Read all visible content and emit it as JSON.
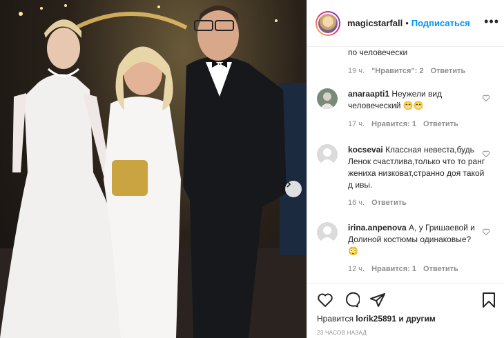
{
  "post": {
    "username": "magicstarfall",
    "separator": "•",
    "follow_label": "Подписаться",
    "more_label": "•••"
  },
  "comments": [
    {
      "text": "по человечески",
      "time": "19 ч.",
      "likes": "\"Нравится\": 2",
      "reply": "Ответить"
    },
    {
      "user": "anaraapti1",
      "text": "Неужели вид человеческий",
      "emoji": "😁😁",
      "time": "17 ч.",
      "likes": "Нравится: 1",
      "reply": "Ответить"
    },
    {
      "user": "kocsevai",
      "text": "Классная невеста,будь Ленок счастлива,только что то ранг жениха низковат,странно доя такой д ивы.",
      "time": "16 ч.",
      "reply": "Ответить"
    },
    {
      "user": "irina.anpenova",
      "text": "А, у Гришаевой и Долиной костюмы одинаковые?",
      "emoji": "😳",
      "time": "12 ч.",
      "likes": "Нравится: 1",
      "reply": "Ответить"
    }
  ],
  "footer": {
    "liked_prefix": "Нравится",
    "liked_user": "lorik25891",
    "liked_suffix": "и другим",
    "time_ago": "23 ЧАСОВ НАЗАД"
  },
  "colors": {
    "link_blue": "#0095f6",
    "text": "#262626",
    "muted": "#8e8e8e",
    "border": "#efefef"
  },
  "icons": [
    "heart-icon",
    "comment-icon",
    "share-icon",
    "bookmark-icon",
    "chevron-right-icon",
    "more-icon"
  ]
}
